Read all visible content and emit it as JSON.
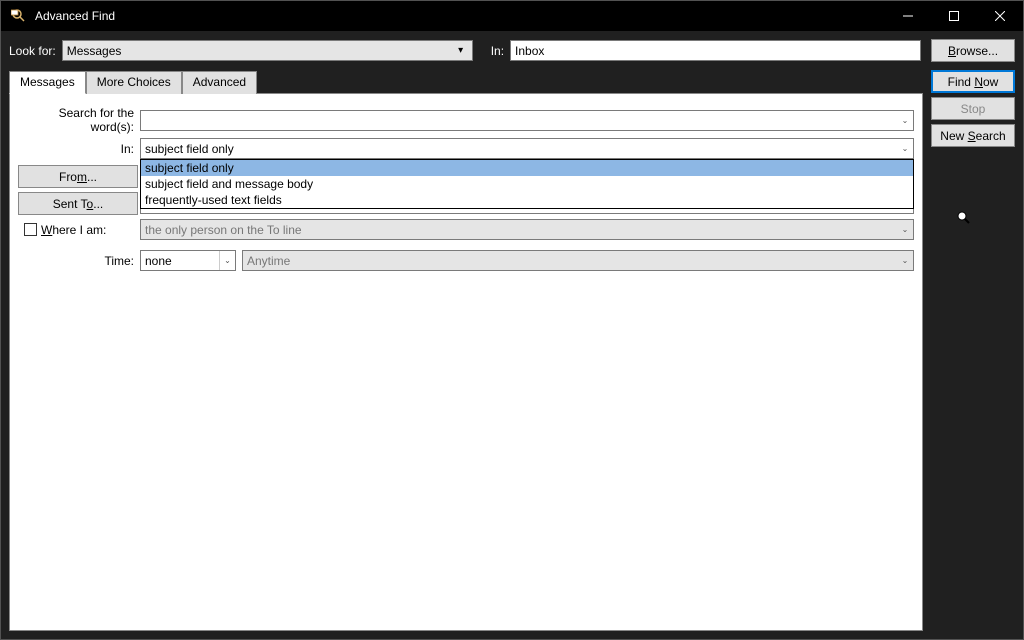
{
  "window": {
    "title": "Advanced Find"
  },
  "top": {
    "look_for_label": "Look for:",
    "look_for_value": "Messages",
    "in_label": "In:",
    "in_value": "Inbox",
    "browse_label": "Browse..."
  },
  "tabs": {
    "messages": "Messages",
    "more_choices": "More Choices",
    "advanced": "Advanced"
  },
  "form": {
    "search_label": "Search for the word(s):",
    "search_value": "",
    "in_label": "In:",
    "in_value": "subject field only",
    "in_options": [
      "subject field only",
      "subject field and message body",
      "frequently-used text fields"
    ],
    "from_label": "From...",
    "from_value": "",
    "sent_to_label": "Sent To...",
    "sent_to_value": "",
    "where_label": "Where I am:",
    "where_value": "the only person on the To line",
    "time_label": "Time:",
    "time_value": "none",
    "time_range_value": "Anytime"
  },
  "side": {
    "find_now": "Find Now",
    "stop": "Stop",
    "new_search": "New Search"
  }
}
